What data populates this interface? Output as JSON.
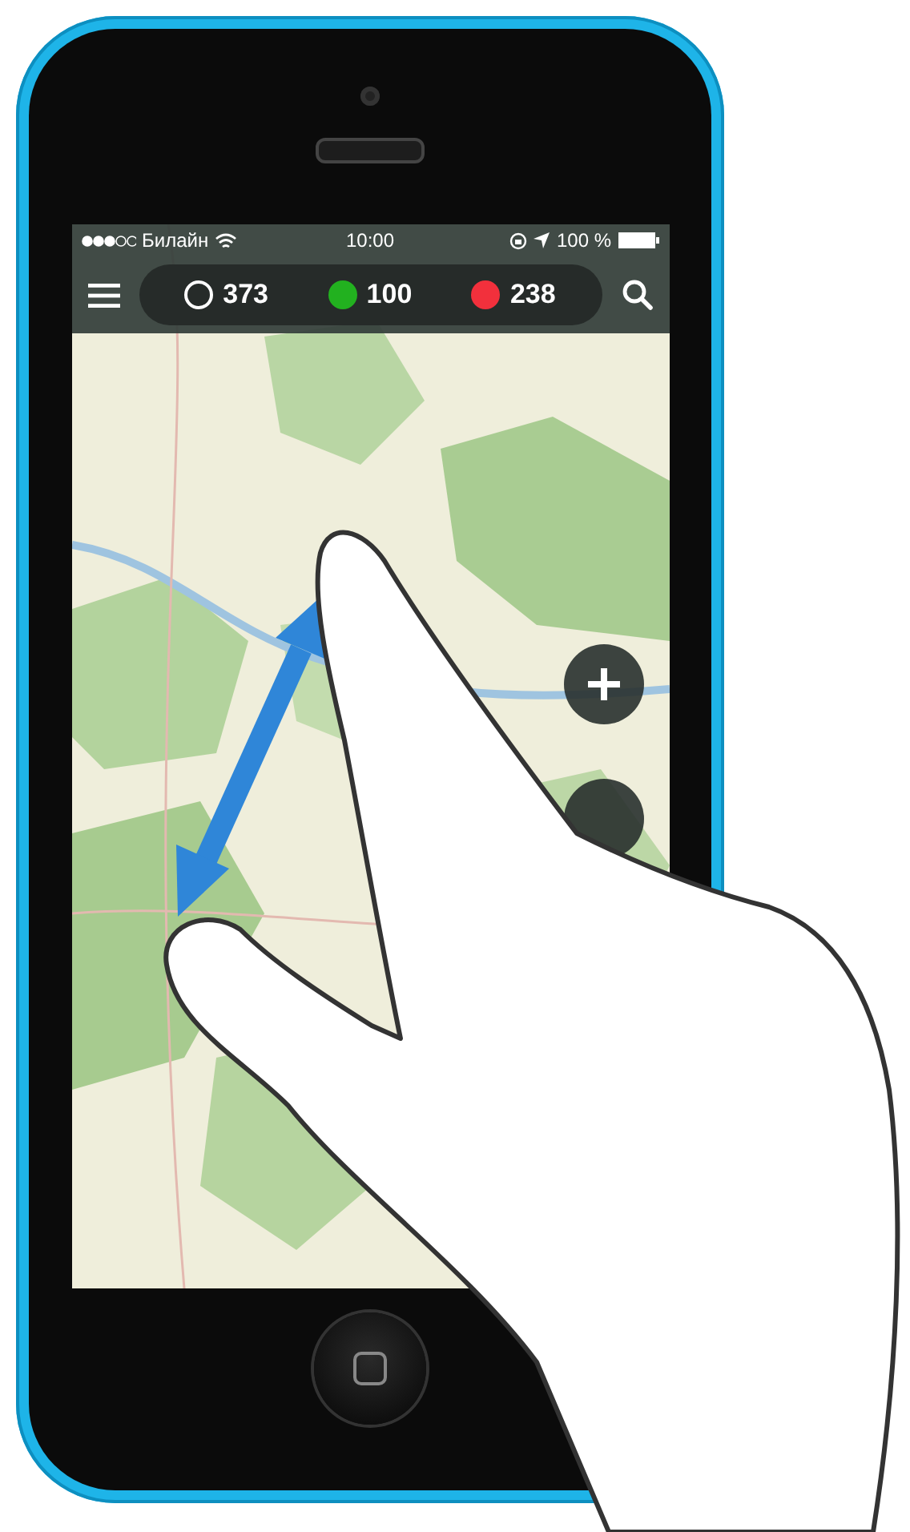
{
  "status_bar": {
    "carrier": "Билайн",
    "time": "10:00",
    "battery": "100 %"
  },
  "toolbar": {
    "counters": [
      {
        "kind": "ring",
        "color": "#ffffff",
        "count": "373"
      },
      {
        "kind": "dot",
        "color": "#22b11f",
        "count": "100"
      },
      {
        "kind": "dot",
        "color": "#f2303c",
        "count": "238"
      }
    ]
  }
}
